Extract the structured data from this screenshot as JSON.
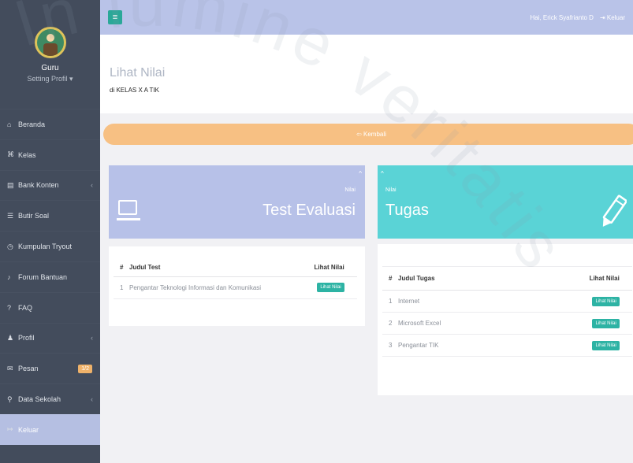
{
  "sidebar": {
    "profile": {
      "name": "Guru",
      "setting": "Setting Profil ▾"
    },
    "items": [
      {
        "icon": "home-icon",
        "glyph": "⌂",
        "label": "Beranda"
      },
      {
        "icon": "class-icon",
        "glyph": "⌘",
        "label": "Kelas"
      },
      {
        "icon": "bank-icon",
        "glyph": "▤",
        "label": "Bank Konten",
        "chevron": "‹"
      },
      {
        "icon": "list-icon",
        "glyph": "☰",
        "label": "Butir Soal"
      },
      {
        "icon": "tryout-icon",
        "glyph": "◷",
        "label": "Kumpulan Tryout"
      },
      {
        "icon": "forum-icon",
        "glyph": "♪",
        "label": "Forum Bantuan"
      },
      {
        "icon": "question-icon",
        "glyph": "?",
        "label": "FAQ"
      },
      {
        "icon": "user-icon",
        "glyph": "♟",
        "label": "Profil",
        "chevron": "‹"
      },
      {
        "icon": "envelope-icon",
        "glyph": "✉",
        "label": "Pesan",
        "badge": "1/2"
      },
      {
        "icon": "search-icon",
        "glyph": "⚲",
        "label": "Data Sekolah",
        "chevron": "‹"
      },
      {
        "icon": "logout-icon",
        "glyph": "↦",
        "label": "Keluar",
        "active": true
      }
    ]
  },
  "topbar": {
    "menu_glyph": "≡",
    "user": "Hai, Erick Syafrianto D",
    "logout": "⇥ Keluar"
  },
  "header": {
    "title": "Lihat Nilai",
    "subtitle": "di KELAS X A TIK"
  },
  "back_button": "⇦ Kembali",
  "eval_widget": {
    "caret": "^",
    "small": "Nilai",
    "title": "Test Evaluasi"
  },
  "tugas_widget": {
    "caret": "^",
    "small": "Nilai",
    "title": "Tugas"
  },
  "eval_table": {
    "headers": [
      "#",
      "Judul Test",
      "Lihat Nilai"
    ],
    "rows": [
      {
        "num": "1",
        "title": "Pengantar Teknologi Informasi dan Komunikasi",
        "action": "Lihat Nilai"
      }
    ]
  },
  "tugas_table": {
    "headers": [
      "#",
      "Judul Tugas",
      "Lihat Nilai"
    ],
    "rows": [
      {
        "num": "1",
        "title": "Internet",
        "action": "Lihat Nilai"
      },
      {
        "num": "2",
        "title": "Microsoft Excel",
        "action": "Lihat Nilai"
      },
      {
        "num": "3",
        "title": "Pengantar TIK",
        "action": "Lihat Nilai"
      }
    ]
  },
  "watermark": "In lumine veritatis"
}
